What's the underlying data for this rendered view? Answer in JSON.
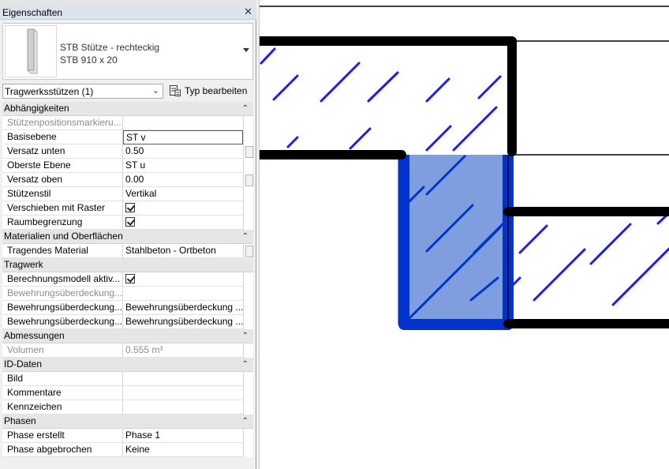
{
  "panel": {
    "title": "Eigenschaften",
    "close_glyph": "✕",
    "type_selector": {
      "name_line1": "STB Stütze - rechteckig",
      "name_line2": "STB 910 x 20"
    },
    "filter_value": "Tragwerksstützen (1)",
    "edit_type_label": "Typ bearbeiten"
  },
  "groups": {
    "g1": {
      "label": "Abhängigkeiten",
      "collapse": "⌃"
    },
    "g2": {
      "label": "Materialien und Oberflächen",
      "collapse": "⌃"
    },
    "g3": {
      "label": "Tragwerk"
    },
    "g4": {
      "label": "Abmessungen",
      "collapse": "⌃"
    },
    "g5": {
      "label": "ID-Daten",
      "collapse": "⌃"
    },
    "g6": {
      "label": "Phasen",
      "collapse": "⌃"
    }
  },
  "rows": {
    "r1": {
      "key": "Stützenpositionsmarkieru...",
      "value": ""
    },
    "r2": {
      "key": "Basisebene",
      "value": "ST v"
    },
    "r3": {
      "key": "Versatz unten",
      "value": "0.50"
    },
    "r4": {
      "key": "Oberste Ebene",
      "value": "ST u"
    },
    "r5": {
      "key": "Versatz oben",
      "value": "0.00"
    },
    "r6": {
      "key": "Stützenstil",
      "value": "Vertikal"
    },
    "r7": {
      "key": "Verschieben mit Raster",
      "checked": true
    },
    "r8": {
      "key": "Raumbegrenzung",
      "checked": true
    },
    "r9": {
      "key": "Tragendes Material",
      "value": "Stahlbeton - Ortbeton"
    },
    "r10": {
      "key": "Berechnungsmodell aktiv...",
      "checked": true
    },
    "r11": {
      "key": "Bewehrungsüberdeckung...",
      "value": ""
    },
    "r12": {
      "key": "Bewehrungsüberdeckung...",
      "value": "Bewehrungsüberdeckung ..."
    },
    "r13": {
      "key": "Bewehrungsüberdeckung...",
      "value": "Bewehrungsüberdeckung ..."
    },
    "r14": {
      "key": "Volumen",
      "value": "0.555 m³"
    },
    "r15": {
      "key": "Bild",
      "value": ""
    },
    "r16": {
      "key": "Kommentare",
      "value": ""
    },
    "r17": {
      "key": "Kennzeichen",
      "value": ""
    },
    "r18": {
      "key": "Phase erstellt",
      "value": "Phase 1"
    },
    "r19": {
      "key": "Phase abgebrochen",
      "value": "Keine"
    }
  },
  "colors": {
    "hatch": "#1a1aff",
    "selected_fill": "#7f9ee0",
    "selected_edge": "#0033cc",
    "outline": "#000000"
  }
}
